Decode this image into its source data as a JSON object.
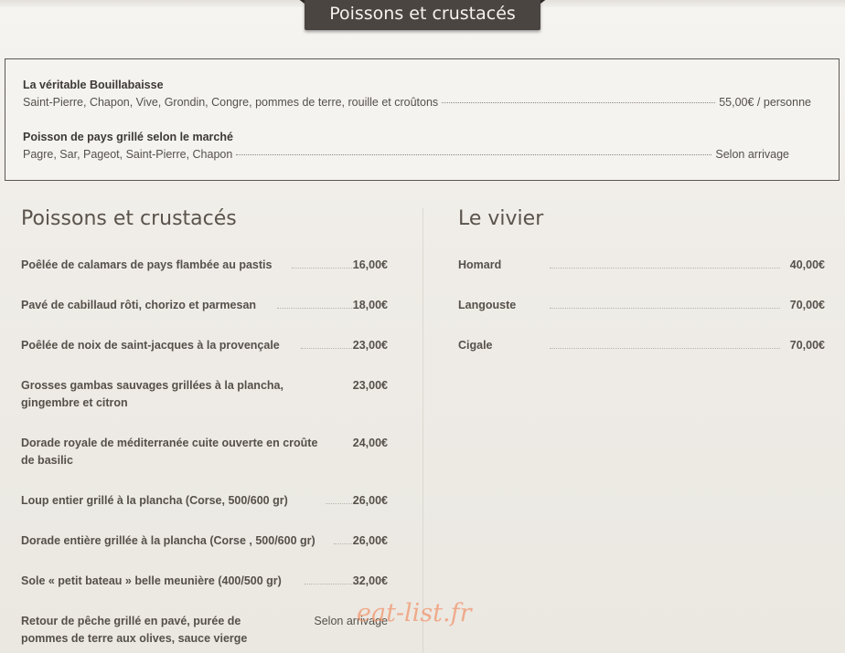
{
  "header": {
    "title": "Poissons et crustacés"
  },
  "specials": [
    {
      "name": "La véritable Bouillabaisse",
      "description": "Saint-Pierre, Chapon, Vive, Grondin, Congre, pommes de terre, rouille et croûtons",
      "price": "55,00€ / personne"
    },
    {
      "name": "Poisson de pays grillé selon le marché",
      "description": "Pagre, Sar, Pageot, Saint-Pierre, Chapon",
      "price": "Selon arrivage"
    }
  ],
  "left_section": {
    "title": "Poissons et crustacés",
    "items": [
      {
        "name": "Poêlée de calamars de pays flambée au pastis",
        "price": "16,00€"
      },
      {
        "name": "Pavé de cabillaud rôti, chorizo et parmesan",
        "price": "18,00€"
      },
      {
        "name": "Poêlée de noix de saint-jacques à la provençale",
        "price": "23,00€"
      },
      {
        "name": "Grosses gambas sauvages grillées à la plancha,",
        "name2": "gingembre et citron",
        "price": "23,00€"
      },
      {
        "name": "Dorade royale de méditerranée cuite ouverte en croûte",
        "name2": "de basilic",
        "price": "24,00€"
      },
      {
        "name": "Loup entier grillé à la plancha (Corse, 500/600 gr)",
        "price": "26,00€"
      },
      {
        "name": "Dorade entière grillée à la plancha (Corse , 500/600 gr)",
        "price": "26,00€"
      },
      {
        "name": "Sole « petit bateau » belle meunière (400/500 gr)",
        "price": "32,00€"
      },
      {
        "name": "Retour de pêche grillé en pavé, purée de",
        "name2": "pommes de terre aux olives, sauce vierge",
        "price": "Selon arrivage"
      }
    ]
  },
  "right_section": {
    "title": "Le vivier",
    "items": [
      {
        "name": "Homard",
        "price": "40,00€"
      },
      {
        "name": "Langouste",
        "price": "70,00€"
      },
      {
        "name": "Cigale",
        "price": "70,00€"
      }
    ]
  },
  "watermark": "eat-list.fr"
}
